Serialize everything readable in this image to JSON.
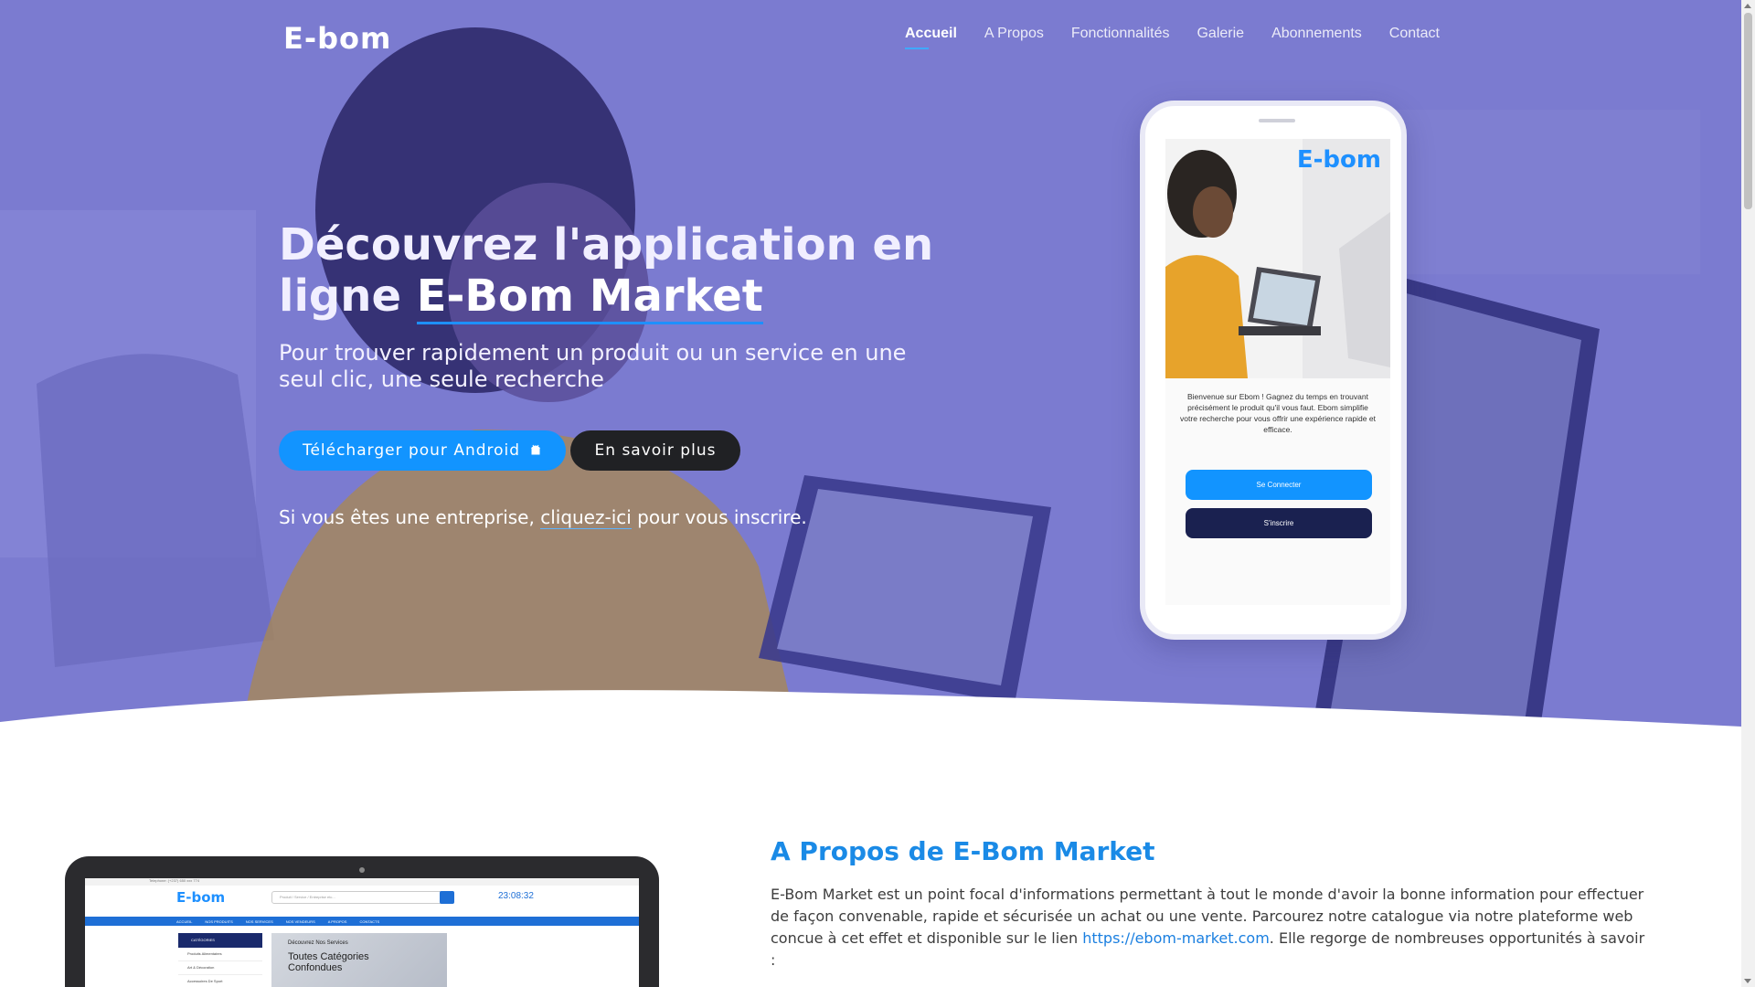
{
  "header": {
    "logo_text": "E-bom",
    "nav": [
      "Accueil",
      "A Propos",
      "Fonctionnalités",
      "Galerie",
      "Abonnements",
      "Contact"
    ],
    "active_nav": "Accueil"
  },
  "hero": {
    "title_prefix": "Découvrez l'application en ligne ",
    "title_brand": "E-Bom Market",
    "subtitle": "Pour trouver rapidement un produit ou un service en une seul clic, une seule recherche",
    "android_button": "Télécharger pour Android",
    "android_icon": "android-icon",
    "more_button": "En savoir plus",
    "note_prefix": "Si vous êtes une entreprise, ",
    "note_link": "cliquez-ici",
    "note_suffix": " pour vous inscrire."
  },
  "phone": {
    "logo_text": "E-bom",
    "welcome_text": "Bienvenue sur Ebom ! Gagnez du temps en trouvant précisément le produit qu'il vous faut. Ebom simplifie votre recherche pour vous offrir une expérience rapide et efficace.",
    "connect_button": "Se Connecter",
    "signup_button": "S'inscrire"
  },
  "laptop_preview": {
    "topbar": "Telephone: (+237) 650 xxx 774",
    "logo_text": "E-bom",
    "search_placeholder": "Produit / Service / Entreprise etc...",
    "clock": "23:08:32",
    "menu": [
      "ACCUEIL",
      "NOS PRODUITS",
      "NOS SERVICES",
      "NOS VENDEURS",
      "A PROPOS",
      "CONTACTS"
    ],
    "categories_header": "CATÉGORIES",
    "categories": [
      "Produits Alimentaires",
      "Art & Décoration",
      "Accessoires De Sport"
    ],
    "banner_line1": "Découvrez Nos Services",
    "banner_line2": "Toutes Catégories Confondues"
  },
  "about": {
    "title": "A Propos de E-Bom Market",
    "text_before_link": "E-Bom Market est un point focal d'informations permettant à tout le monde d'avoir la bonne information pour effectuer de façon convenable, rapide et sécurisée un achat ou une vente. Parcourez notre catalogue via notre plateforme web concue à cet effet et disponible sur le lien ",
    "link": "https://ebom-market.com",
    "text_after_link": ". Elle regorge de nombreuses opportunités à savoir :"
  },
  "colors": {
    "hero_bg": "#7676cc",
    "accent_blue": "#1294ff",
    "dark_button": "#202124",
    "about_title": "#1a8ae6"
  }
}
